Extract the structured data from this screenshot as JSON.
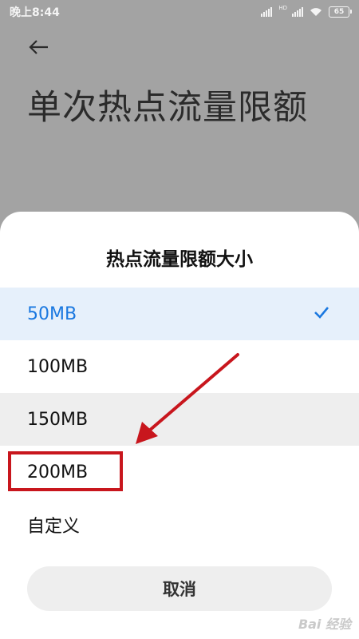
{
  "status_bar": {
    "time": "晚上8:44",
    "network_label": "HD",
    "battery": "65"
  },
  "background_page": {
    "title": "单次热点流量限额"
  },
  "sheet": {
    "title": "热点流量限额大小",
    "options": [
      {
        "label": "50MB",
        "selected": true
      },
      {
        "label": "100MB",
        "selected": false
      },
      {
        "label": "150MB",
        "selected": false
      },
      {
        "label": "200MB",
        "selected": false
      },
      {
        "label": "自定义",
        "selected": false
      }
    ],
    "cancel_label": "取消"
  },
  "watermark": "Bai 经验",
  "colors": {
    "accent": "#1a78e0",
    "annotation": "#c8161d",
    "selected_bg": "#e6f0fb"
  },
  "icons": [
    "back-arrow-icon",
    "check-icon",
    "signal-icon",
    "wifi-icon",
    "battery-icon"
  ]
}
